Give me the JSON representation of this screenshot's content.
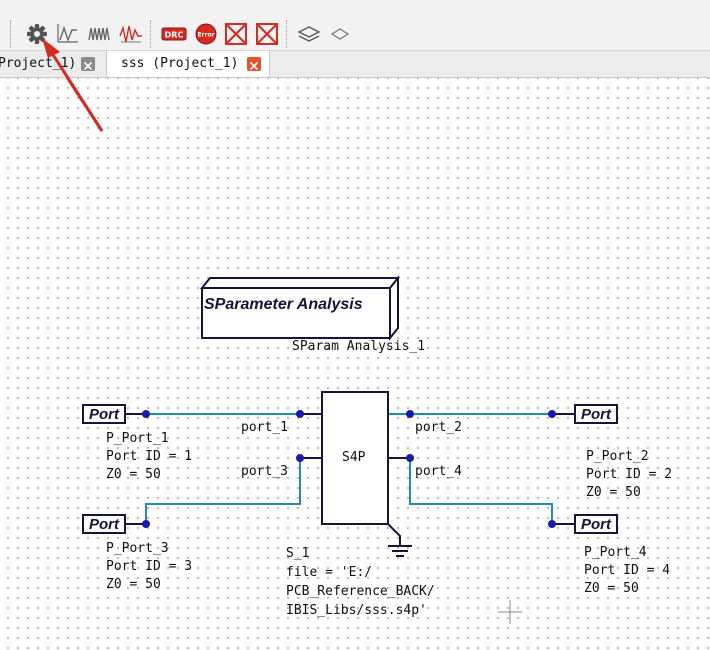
{
  "toolbar": {
    "buttons": [
      {
        "name": "settings",
        "icon": "gear-icon"
      },
      {
        "name": "waveform",
        "icon": "waveform-icon"
      },
      {
        "name": "waveform-multi",
        "icon": "waveform-multi-icon"
      },
      {
        "name": "waveform-error",
        "icon": "waveform-error-icon"
      },
      {
        "name": "drc",
        "icon": "drc-icon",
        "label": "DRC"
      },
      {
        "name": "error",
        "icon": "error-icon",
        "label": "Error"
      },
      {
        "name": "delete-cross",
        "icon": "box-cross-icon"
      },
      {
        "name": "delete-cross-2",
        "icon": "box-cross-icon"
      },
      {
        "name": "layers",
        "icon": "layers-icon"
      },
      {
        "name": "diamond",
        "icon": "diamond-icon"
      }
    ],
    "accent_red": "#d42b22"
  },
  "tabs": [
    {
      "label": "Project_1)",
      "active": false
    },
    {
      "label": "sss (Project_1)",
      "active": true
    }
  ],
  "analysis": {
    "title": "SParameter Analysis",
    "instance": "SParam Analysis_1"
  },
  "ports": [
    {
      "box_label": "Port",
      "name": "P_Port_1",
      "id_line": "Port ID = 1",
      "z_line": "Z0 = 50"
    },
    {
      "box_label": "Port",
      "name": "P_Port_2",
      "id_line": "Port ID = 2",
      "z_line": "Z0 = 50"
    },
    {
      "box_label": "Port",
      "name": "P_Port_3",
      "id_line": "Port ID = 3",
      "z_line": "Z0 = 50"
    },
    {
      "box_label": "Port",
      "name": "P_Port_4",
      "id_line": "Port ID = 4",
      "z_line": "Z0 = 50"
    }
  ],
  "component": {
    "label": "S4P",
    "pins": [
      "port_1",
      "port_2",
      "port_3",
      "port_4"
    ],
    "instance": "S_1",
    "file_lines": [
      "file = 'E:/",
      "PCB_Reference_BACK/",
      "IBIS_Libs/sss.s4p'"
    ]
  },
  "colors": {
    "wire": "#1f8fae",
    "node": "#1a1ab0",
    "outline": "#14143c"
  }
}
